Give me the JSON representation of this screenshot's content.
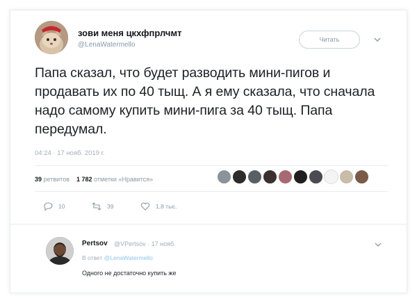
{
  "tweet": {
    "author_name": "зови меня цкхфпрлчмт",
    "author_handle": "@LenaWatermello",
    "follow_label": "Читать",
    "text": "Папа сказал, что будет разводить мини-пигов и продавать их по 40 тыщ. А я ему сказала, что сначала надо самому купить мини-пига за 40 тыщ. Папа передумал.",
    "time": "04:24",
    "date": "17 нояб. 2019 г.",
    "retweets_count": "39",
    "retweets_label": "ретвитов",
    "likes_count": "1 782",
    "likes_label": "отметки «Нравится»",
    "actions": {
      "replies": "10",
      "retweets": "39",
      "likes": "1,8 тыс."
    }
  },
  "reply": {
    "author_name": "Pertsov",
    "author_handle": "@VPertsov",
    "date": "17 нояб.",
    "in_reply_label": "В ответ",
    "in_reply_handle": "@LenaWatermello",
    "text": "Одного не достаточно купить же"
  },
  "colors": {
    "accent_link": "#8fc4ec",
    "muted": "#8899a6",
    "text": "#14171a",
    "border": "#e6ecf0"
  }
}
